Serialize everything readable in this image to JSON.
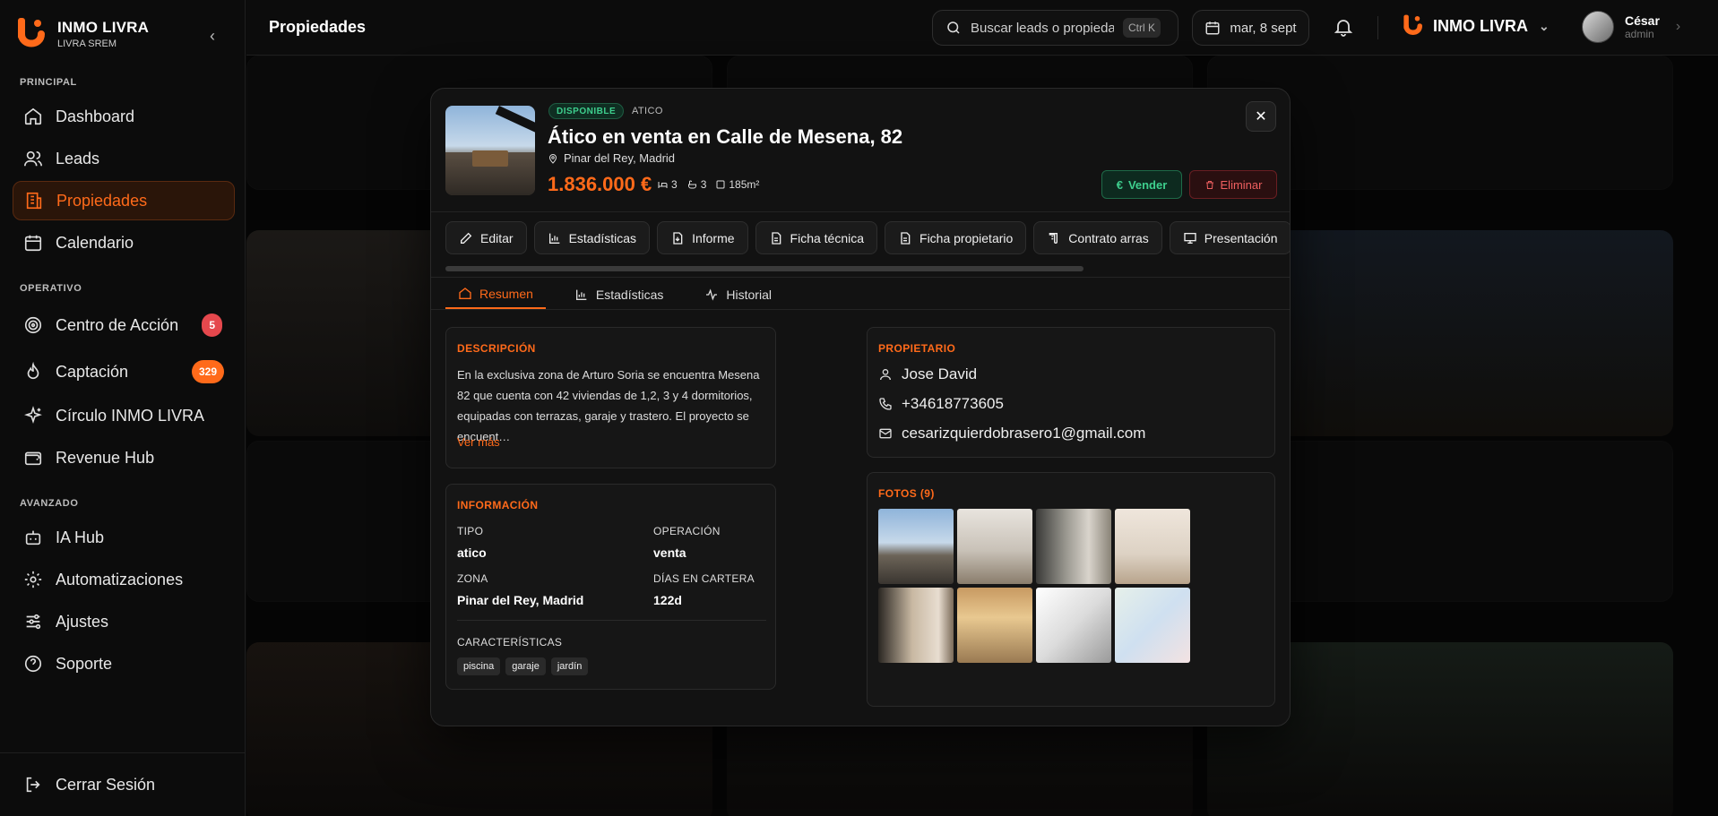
{
  "brand": {
    "name": "INMO LIVRA",
    "sub": "LIVRA SREM"
  },
  "sidebar": {
    "sections": {
      "principal": "PRINCIPAL",
      "operativo": "OPERATIVO",
      "avanzado": "AVANZADO"
    },
    "items": [
      {
        "label": "Dashboard",
        "icon": "home-icon"
      },
      {
        "label": "Leads",
        "icon": "users-icon"
      },
      {
        "label": "Propiedades",
        "icon": "building-icon",
        "active": true
      },
      {
        "label": "Calendario",
        "icon": "calendar-icon"
      },
      {
        "label": "Centro de Acción",
        "icon": "target-icon",
        "badge": "5"
      },
      {
        "label": "Captación",
        "icon": "flame-icon",
        "badge": "329"
      },
      {
        "label": "Círculo INMO LIVRA",
        "icon": "sparkle-icon"
      },
      {
        "label": "Revenue Hub",
        "icon": "wallet-icon"
      },
      {
        "label": "IA Hub",
        "icon": "bot-icon"
      },
      {
        "label": "Automatizaciones",
        "icon": "gear-icon"
      },
      {
        "label": "Ajustes",
        "icon": "sliders-icon"
      },
      {
        "label": "Soporte",
        "icon": "help-icon"
      }
    ],
    "logout": "Cerrar Sesión"
  },
  "header": {
    "title": "Propiedades",
    "search_placeholder": "Buscar leads o propiedades",
    "shortcut": "Ctrl K",
    "date": "mar, 8 sept",
    "brand": "INMO LIVRA",
    "user": {
      "name": "César",
      "role": "admin"
    }
  },
  "modal": {
    "status": "DISPONIBLE",
    "type_chip": "ATICO",
    "title": "Ático en venta en Calle de Mesena, 82",
    "location": "Pinar del Rey, Madrid",
    "price": "1.836.000 €",
    "beds": "3",
    "baths": "3",
    "area": "185m²",
    "sell_label": "Vender",
    "delete_label": "Eliminar",
    "actions": [
      "Editar",
      "Estadísticas",
      "Informe",
      "Ficha técnica",
      "Ficha propietario",
      "Contrato arras",
      "Presentación"
    ],
    "tabs": [
      "Resumen",
      "Estadísticas",
      "Historial"
    ],
    "description": {
      "title": "DESCRIPCIÓN",
      "text": "En la exclusiva zona de Arturo Soria se encuentra Mesena 82 que cuenta con 42 viviendas de 1,2, 3 y 4 dormitorios, equipadas con terrazas, garaje y trastero. El proyecto se encuent…",
      "more": "Ver más"
    },
    "info": {
      "title": "INFORMACIÓN",
      "tipo_label": "TIPO",
      "tipo": "atico",
      "operacion_label": "OPERACIÓN",
      "operacion": "venta",
      "zona_label": "ZONA",
      "zona": "Pinar del Rey, Madrid",
      "dias_label": "DÍAS EN CARTERA",
      "dias": "122d",
      "carac_label": "CARACTERÍSTICAS",
      "features": [
        "piscina",
        "garaje",
        "jardín"
      ]
    },
    "owner": {
      "title": "PROPIETARIO",
      "name": "Jose David",
      "phone": "+34618773605",
      "email": "cesarizquierdobrasero1@gmail.com"
    },
    "photos": {
      "title": "FOTOS (9)"
    }
  },
  "colors": {
    "accent": "#ff6a1a",
    "success": "#3ecf8e",
    "danger": "#ef5f5f"
  }
}
